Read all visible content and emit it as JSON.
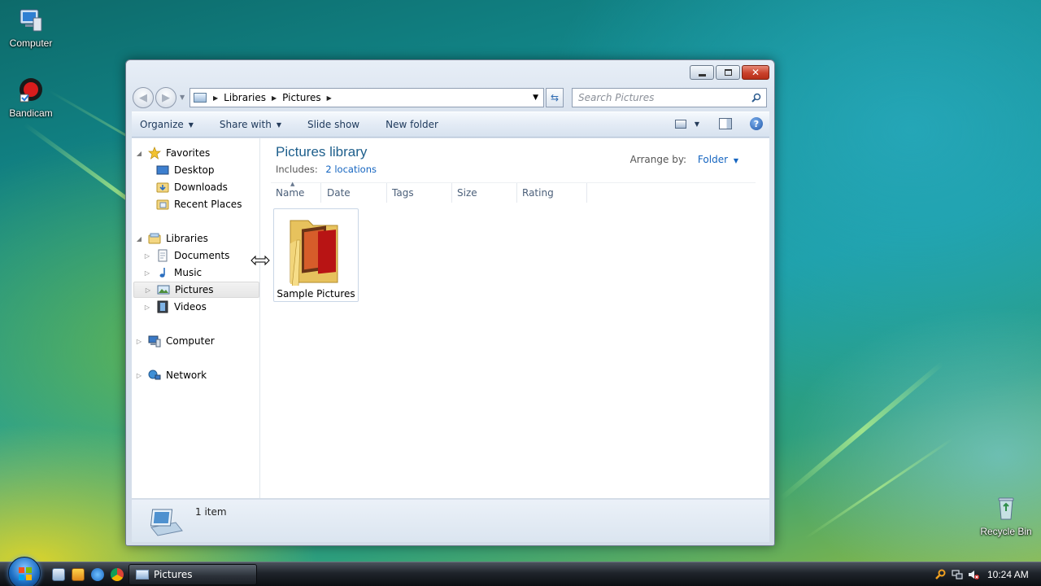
{
  "desktop": {
    "icons": [
      {
        "label": "Computer"
      },
      {
        "label": "Bandicam"
      },
      {
        "label": "Recycle Bin"
      }
    ]
  },
  "window": {
    "breadcrumb": [
      "Libraries",
      "Pictures"
    ],
    "search_placeholder": "Search Pictures",
    "toolbar": {
      "organize": "Organize",
      "share_with": "Share with",
      "slide_show": "Slide show",
      "new_folder": "New folder"
    },
    "nav_pane": {
      "favorites": "Favorites",
      "favorites_items": [
        "Desktop",
        "Downloads",
        "Recent Places"
      ],
      "libraries": "Libraries",
      "libraries_items": [
        "Documents",
        "Music",
        "Pictures",
        "Videos"
      ],
      "computer": "Computer",
      "network": "Network",
      "selected": "Pictures"
    },
    "content": {
      "title": "Pictures library",
      "includes_label": "Includes:",
      "includes_link": "2 locations",
      "arrange_label": "Arrange by:",
      "arrange_value": "Folder",
      "columns": [
        "Name",
        "Date",
        "Tags",
        "Size",
        "Rating"
      ],
      "items": [
        {
          "name": "Sample Pictures"
        }
      ]
    },
    "status": {
      "text": "1 item"
    }
  },
  "taskbar": {
    "task_label": "Pictures",
    "clock": "10:24 AM"
  },
  "colors": {
    "title_blue": "#1e5f8c",
    "link_blue": "#1565c0",
    "close_red": "#c9412b"
  },
  "icons": {
    "favorites": "star-icon",
    "libraries": "library-icon",
    "computer": "computer-icon",
    "network": "network-icon",
    "search": "magnifier-icon",
    "help": "question-icon"
  }
}
